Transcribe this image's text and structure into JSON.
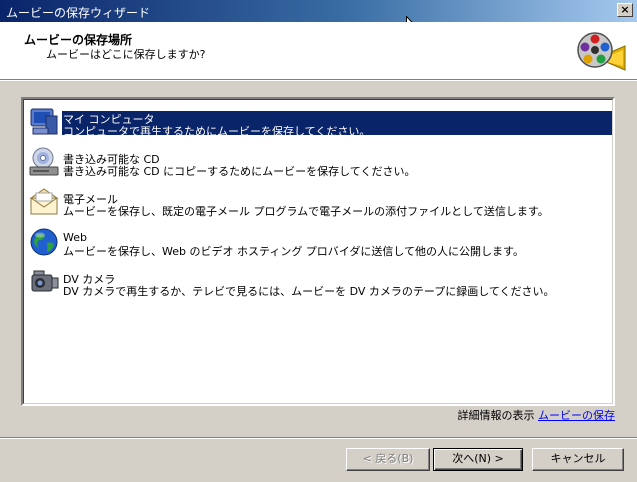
{
  "window": {
    "title": "ムービーの保存ウィザード",
    "close_label": "×"
  },
  "header": {
    "title": "ムービーの保存場所",
    "subtitle": "ムービーはどこに保存しますか?"
  },
  "options": [
    {
      "label": "マイ コンピュータ",
      "desc": "コンピュータで再生するためにムービーを保存してください。",
      "icon": "my-computer-icon",
      "selected": true
    },
    {
      "label": "書き込み可能な CD",
      "desc": "書き込み可能な CD にコピーするためにムービーを保存してください。",
      "icon": "cd-drive-icon",
      "selected": false
    },
    {
      "label": "電子メール",
      "desc": "ムービーを保存し、既定の電子メール プログラムで電子メールの添付ファイルとして送信します。",
      "icon": "email-icon",
      "selected": false
    },
    {
      "label": "Web",
      "desc": "ムービーを保存し、Web のビデオ ホスティング プロバイダに送信して他の人に公開します。",
      "icon": "globe-icon",
      "selected": false
    },
    {
      "label": "DV カメラ",
      "desc": "DV カメラで再生するか、テレビで見るには、ムービーを DV カメラのテープに録画してください。",
      "icon": "camcorder-icon",
      "selected": false
    }
  ],
  "more_info": {
    "text": "詳細情報の表示",
    "link": "ムービーの保存"
  },
  "buttons": {
    "back": "< 戻る(B)",
    "next": "次へ(N) >",
    "cancel": "キャンセル"
  },
  "colors": {
    "selection": "#0a246a",
    "titlebar": "#0a246a",
    "link": "#0000ff",
    "face": "#d4d0c8"
  }
}
